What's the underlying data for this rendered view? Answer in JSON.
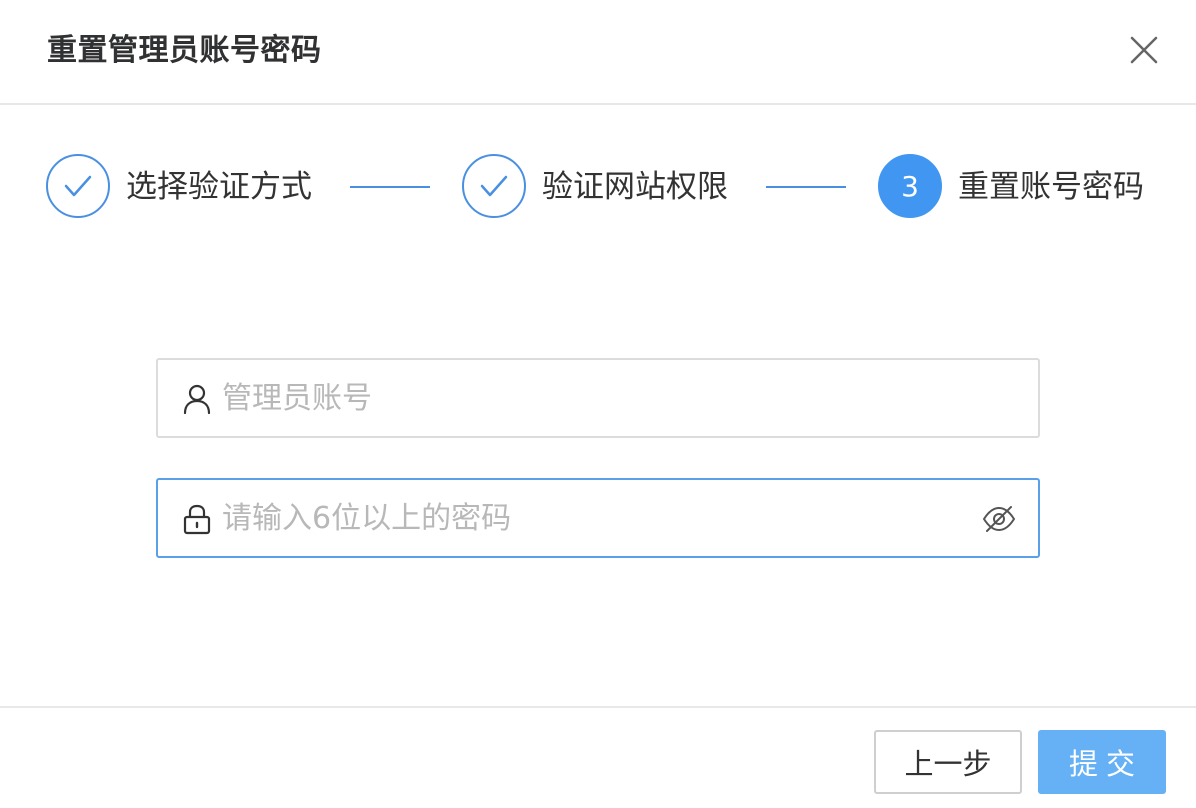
{
  "dialog": {
    "title": "重置管理员账号密码",
    "close_icon": "close-icon"
  },
  "steps": [
    {
      "label": "选择验证方式",
      "status": "done",
      "icon": "check-icon"
    },
    {
      "label": "验证网站权限",
      "status": "done",
      "icon": "check-icon"
    },
    {
      "label": "重置账号密码",
      "status": "active",
      "number": "3"
    }
  ],
  "form": {
    "account": {
      "placeholder": "管理员账号",
      "value": "",
      "icon": "user-icon"
    },
    "password": {
      "placeholder": "请输入6位以上的密码",
      "value": "",
      "icon": "lock-icon",
      "toggle_icon": "eye-off-icon"
    }
  },
  "footer": {
    "prev_label": "上一步",
    "submit_label": "提交"
  },
  "colors": {
    "accent": "#4096f0",
    "submit_bg": "#66b1f5",
    "border": "#dcdcdc",
    "focus_border": "#5aa0e8"
  }
}
